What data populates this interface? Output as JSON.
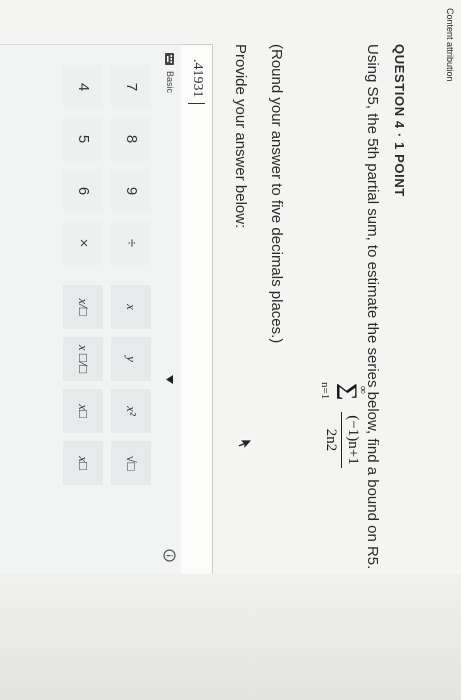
{
  "attribution": "Content attribution",
  "question": {
    "label": "QUESTION 4 · 1 POINT",
    "text": "Using S5, the 5th partial sum, to estimate the series below, find a bound on R5.",
    "series": {
      "upper": "∞",
      "lower": "n=1",
      "numerator": "(−1)n+1",
      "denominator": "2n2"
    },
    "instruction": "(Round your answer to five decimals places.)"
  },
  "answer": {
    "prompt": "Provide your answer below:",
    "value": ".41931"
  },
  "keypad": {
    "mode": "Basic",
    "keys": [
      {
        "label": "7"
      },
      {
        "label": "8"
      },
      {
        "label": "9"
      },
      {
        "label": "÷"
      },
      {
        "label": "x"
      },
      {
        "label": "y"
      },
      {
        "label": "x²"
      },
      {
        "label": "√□"
      },
      {
        "label": "4"
      },
      {
        "label": "5"
      },
      {
        "label": "6"
      },
      {
        "label": "×"
      },
      {
        "label": "x/□"
      },
      {
        "label": "x □/□"
      },
      {
        "label": "x□"
      },
      {
        "label": "x□"
      }
    ]
  },
  "colors": {
    "background": "#f4f4f2",
    "border": "#c9cccc",
    "text": "#2a2a2a"
  }
}
